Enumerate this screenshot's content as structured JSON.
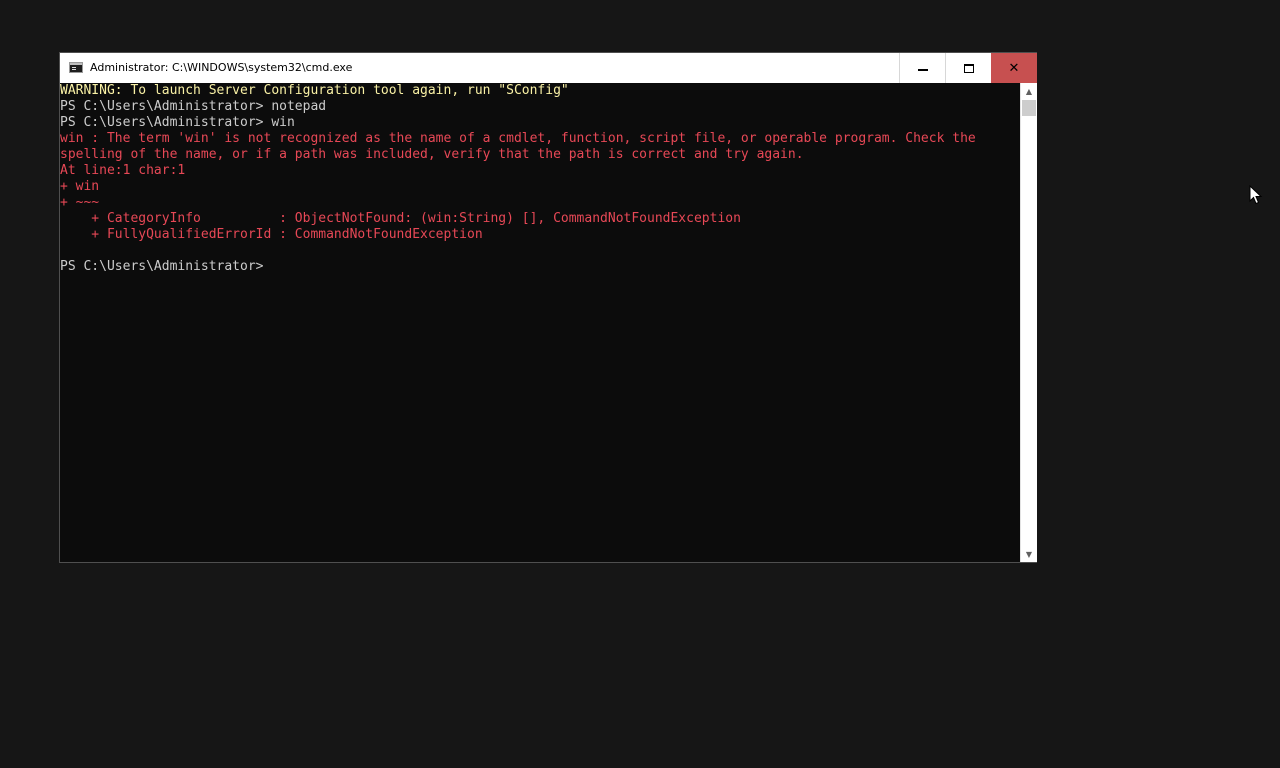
{
  "window": {
    "title": "Administrator: C:\\WINDOWS\\system32\\cmd.exe",
    "minimize_glyph": "minimize-icon",
    "maximize_glyph": "maximize-icon",
    "close_glyph": "✕"
  },
  "colors": {
    "warning": "#f9f1a5",
    "normal": "#cccccc",
    "error": "#e74856",
    "close_bg": "#c75050",
    "console_bg": "#0c0c0c"
  },
  "console": {
    "lines": [
      {
        "text": "WARNING: To launch Server Configuration tool again, run \"SConfig\"",
        "kind": "warning"
      },
      {
        "text": "PS C:\\Users\\Administrator> notepad",
        "kind": "normal"
      },
      {
        "text": "PS C:\\Users\\Administrator> win",
        "kind": "normal"
      },
      {
        "text": "win : The term 'win' is not recognized as the name of a cmdlet, function, script file, or operable program. Check the",
        "kind": "error"
      },
      {
        "text": "spelling of the name, or if a path was included, verify that the path is correct and try again.",
        "kind": "error"
      },
      {
        "text": "At line:1 char:1",
        "kind": "error"
      },
      {
        "text": "+ win",
        "kind": "error"
      },
      {
        "text": "+ ~~~",
        "kind": "error"
      },
      {
        "text": "    + CategoryInfo          : ObjectNotFound: (win:String) [], CommandNotFoundException",
        "kind": "error"
      },
      {
        "text": "    + FullyQualifiedErrorId : CommandNotFoundException",
        "kind": "error"
      },
      {
        "text": "",
        "kind": "normal"
      },
      {
        "text": "PS C:\\Users\\Administrator>",
        "kind": "normal"
      }
    ]
  },
  "scrollbar": {
    "up_arrow": "▲",
    "down_arrow": "▼"
  }
}
